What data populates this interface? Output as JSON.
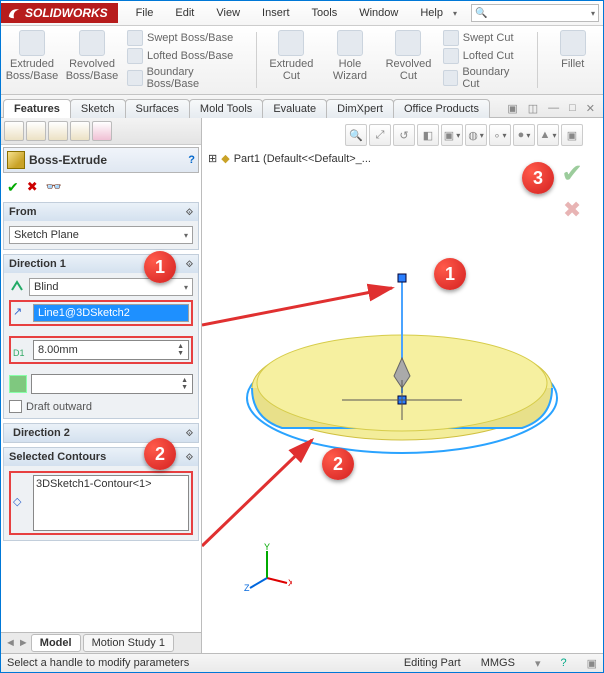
{
  "app_name": "SOLIDWORKS",
  "menu": [
    "File",
    "Edit",
    "View",
    "Insert",
    "Tools",
    "Window",
    "Help"
  ],
  "ribbon": {
    "large": [
      {
        "label": "Extruded Boss/Base"
      },
      {
        "label": "Revolved Boss/Base"
      }
    ],
    "group1": [
      "Swept Boss/Base",
      "Lofted Boss/Base",
      "Boundary Boss/Base"
    ],
    "large2": [
      {
        "label": "Extruded Cut"
      },
      {
        "label": "Hole Wizard"
      },
      {
        "label": "Revolved Cut"
      }
    ],
    "group2": [
      "Swept Cut",
      "Lofted Cut",
      "Boundary Cut"
    ],
    "fillet": "Fillet"
  },
  "tabs": [
    "Features",
    "Sketch",
    "Surfaces",
    "Mold Tools",
    "Evaluate",
    "DimXpert",
    "Office Products"
  ],
  "active_tab": "Features",
  "pm": {
    "title": "Boss-Extrude",
    "from_label": "From",
    "from_value": "Sketch Plane",
    "dir1_label": "Direction 1",
    "dir1_type": "Blind",
    "dir1_ref": "Line1@3DSketch2",
    "dir1_depth": "8.00mm",
    "draft_label": "Draft outward",
    "dir2_label": "Direction 2",
    "sc_label": "Selected Contours",
    "sc_value": "3DSketch1-Contour<1>"
  },
  "tree_text": "Part1 (Default<<Default>_...",
  "bottom_tabs": [
    "Model",
    "Motion Study 1"
  ],
  "status": {
    "hint": "Select a handle to modify parameters",
    "mode": "Editing Part",
    "units": "MMGS"
  },
  "callouts": {
    "c1": "1",
    "c2": "2",
    "c3": "3"
  },
  "triad": {
    "x": "X",
    "y": "Y",
    "z": "Z"
  }
}
